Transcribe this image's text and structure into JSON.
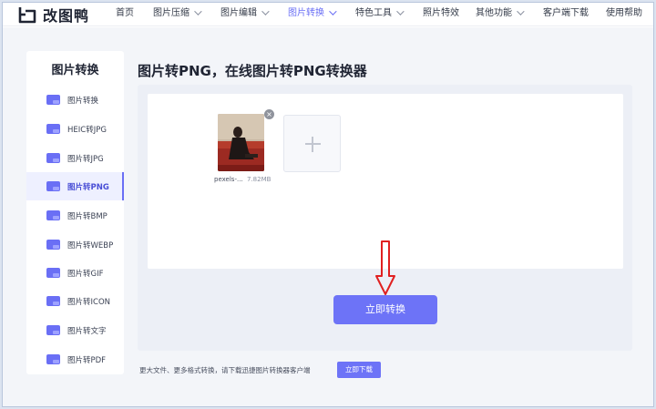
{
  "brand": {
    "name": "改图鸭"
  },
  "nav": {
    "items": [
      {
        "label": "首页",
        "has_menu": false,
        "active": false
      },
      {
        "label": "图片压缩",
        "has_menu": true,
        "active": false
      },
      {
        "label": "图片编辑",
        "has_menu": true,
        "active": false
      },
      {
        "label": "图片转换",
        "has_menu": true,
        "active": true
      },
      {
        "label": "特色工具",
        "has_menu": true,
        "active": false
      },
      {
        "label": "照片特效",
        "has_menu": false,
        "active": false
      },
      {
        "label": "其他功能",
        "has_menu": true,
        "active": false
      },
      {
        "label": "客户端下载",
        "has_menu": false,
        "active": false
      },
      {
        "label": "使用帮助",
        "has_menu": false,
        "active": false
      }
    ]
  },
  "sidebar": {
    "title": "图片转换",
    "items": [
      {
        "label": "图片转换",
        "icon": "image-convert-icon"
      },
      {
        "label": "HEIC转JPG",
        "icon": "heic-file-icon"
      },
      {
        "label": "图片转JPG",
        "icon": "jpg-file-icon"
      },
      {
        "label": "图片转PNG",
        "icon": "png-file-icon",
        "active": true
      },
      {
        "label": "图片转BMP",
        "icon": "bmp-file-icon"
      },
      {
        "label": "图片转WEBP",
        "icon": "webp-file-icon"
      },
      {
        "label": "图片转GIF",
        "icon": "gif-file-icon"
      },
      {
        "label": "图片转ICON",
        "icon": "icon-file-icon"
      },
      {
        "label": "图片转文字",
        "icon": "text-file-icon"
      },
      {
        "label": "图片转PDF",
        "icon": "pdf-file-icon"
      }
    ]
  },
  "main": {
    "title": "图片转PNG，在线图片转PNG转换器",
    "file": {
      "name": "pexels-...",
      "size": "7.82MB"
    },
    "convert_label": "立即转换",
    "footer_text": "更大文件、更多格式转换，请下载迅捷图片转换器客户端",
    "download_label": "立即下载"
  },
  "colors": {
    "accent": "#6d73f7",
    "annotation_arrow": "#e02020"
  }
}
